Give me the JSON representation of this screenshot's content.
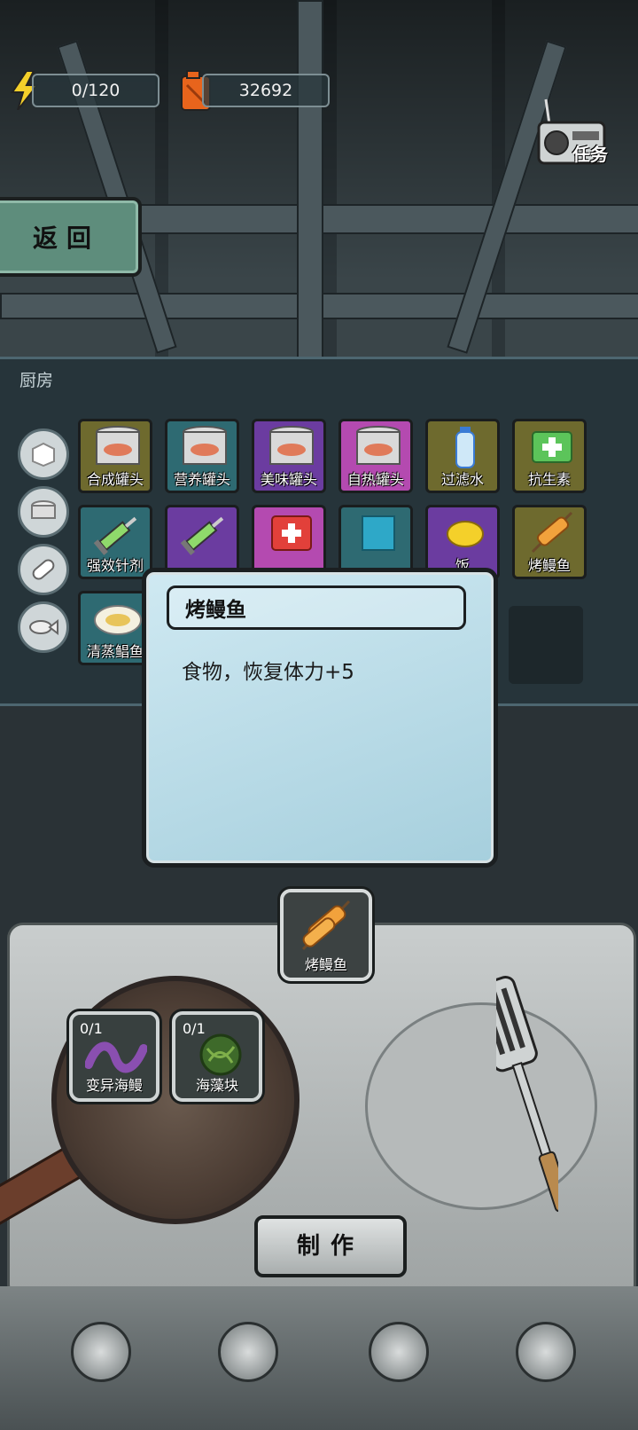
{
  "hud": {
    "energy": "0/120",
    "fuel": "32692",
    "quest_label": "任务"
  },
  "back_label": "返回",
  "kitchen": {
    "title": "厨房",
    "categories": [
      "block-icon",
      "can-icon",
      "pill-icon",
      "fish-icon"
    ],
    "items": [
      {
        "label": "合成罐头",
        "bg": "#6e6a2e",
        "icon": "can"
      },
      {
        "label": "营养罐头",
        "bg": "#2e6a72",
        "icon": "can"
      },
      {
        "label": "美味罐头",
        "bg": "#6b3ca0",
        "icon": "can"
      },
      {
        "label": "自热罐头",
        "bg": "#b44ab0",
        "icon": "can"
      },
      {
        "label": "过滤水",
        "bg": "#6e6a2e",
        "icon": "bottle"
      },
      {
        "label": "抗生素",
        "bg": "#6e6a2e",
        "icon": "pack"
      },
      {
        "label": "强效针剂",
        "bg": "#2e6a72",
        "icon": "syringe"
      },
      {
        "label": "",
        "bg": "#6b3ca0",
        "icon": "syringe"
      },
      {
        "label": "",
        "bg": "#b44ab0",
        "icon": "medpack"
      },
      {
        "label": "",
        "bg": "#2e6a72",
        "icon": "packet"
      },
      {
        "label": "饭",
        "bg": "#6b3ca0",
        "icon": "corn"
      },
      {
        "label": "烤鳗鱼",
        "bg": "#6e6a2e",
        "icon": "eel"
      },
      {
        "label": "清蒸鲳鱼",
        "bg": "#2e6a72",
        "icon": "fish"
      }
    ]
  },
  "tooltip": {
    "title": "烤鳗鱼",
    "description": "食物，恢复体力+5"
  },
  "recipe": {
    "result_label": "烤鳗鱼",
    "ingredients": [
      {
        "count": "0/1",
        "label": "变异海鳗"
      },
      {
        "count": "0/1",
        "label": "海藻块"
      }
    ]
  },
  "make_label": "制作",
  "colors": {
    "accent_green": "#5e8d7c",
    "panel": "#26343a",
    "tooltip": "#bfe0ec"
  }
}
